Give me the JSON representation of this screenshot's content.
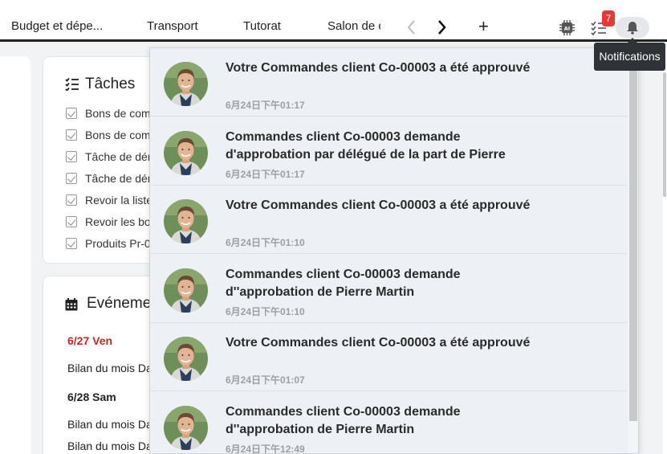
{
  "tabs": [
    {
      "label": "Budget et dépe..."
    },
    {
      "label": "Transport"
    },
    {
      "label": "Tutorat"
    },
    {
      "label": "Salon de c"
    }
  ],
  "header": {
    "badge_count": "7",
    "tooltip": "Notifications",
    "icons": [
      "chevron-left-icon",
      "chevron-right-icon",
      "plus-icon",
      "ai-chip-icon",
      "task-list-icon",
      "bell-icon"
    ]
  },
  "tasks": {
    "title": "Tâches",
    "items": [
      {
        "label": "Bons de com"
      },
      {
        "label": "Bons de com"
      },
      {
        "label": "Tâche de dér"
      },
      {
        "label": "Tâche de dér"
      },
      {
        "label": "Revoir la liste"
      },
      {
        "label": "Revoir les bo"
      },
      {
        "label": "Produits Pr-0"
      }
    ]
  },
  "events": {
    "title": "Evénemer",
    "groups": [
      {
        "date": "6/27 Ven",
        "items": [
          "Bilan du mois Da"
        ]
      },
      {
        "date": "6/28 Sam",
        "items": [
          "Bilan du mois Da",
          "Bilan du mois Da"
        ]
      }
    ]
  },
  "notifications": [
    {
      "message": "Votre Commandes client Co-00003 a été approuvé",
      "time": "6月24日下午01:17"
    },
    {
      "message": "Commandes client Co-00003 demande d'approbation par délégué de la part de Pierre",
      "time": "6月24日下午01:17"
    },
    {
      "message": "Votre Commandes client Co-00003 a été approuvé",
      "time": "6月24日下午01:10"
    },
    {
      "message": "Commandes client Co-00003 demande d''approbation de Pierre Martin",
      "time": "6月24日下午01:10"
    },
    {
      "message": "Votre Commandes client Co-00003 a été approuvé",
      "time": "6月24日下午01:07"
    },
    {
      "message": "Commandes client Co-00003 demande d''approbation de Pierre Martin",
      "time": "6月24日下午12:49"
    }
  ],
  "colors": {
    "badge": "#e53935",
    "event_date_red": "#c62828",
    "panel_bg": "#edf1f5"
  }
}
